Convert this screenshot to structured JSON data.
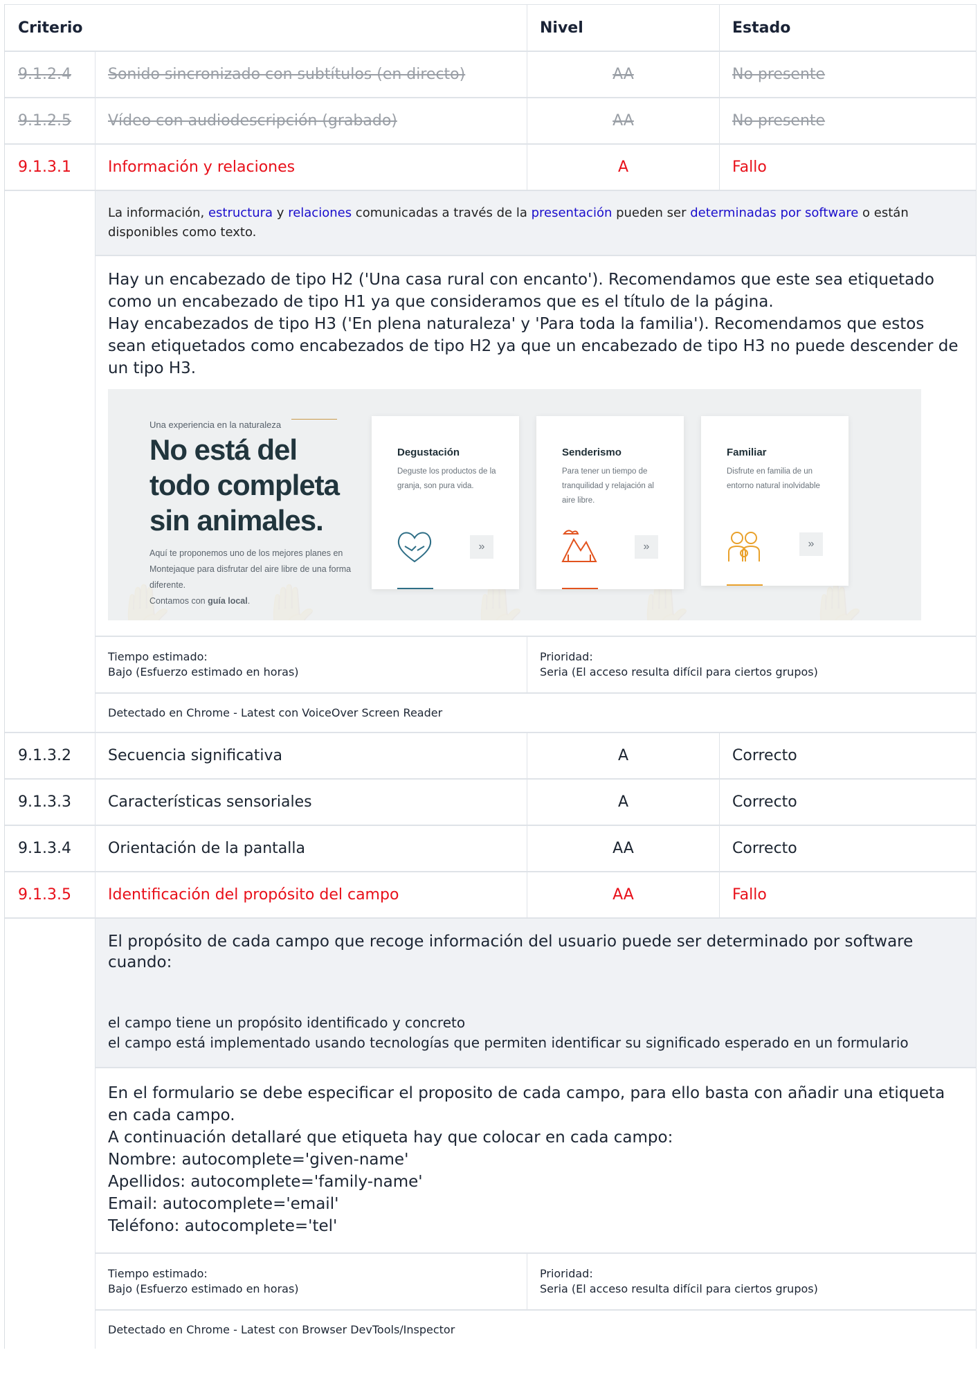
{
  "header": {
    "criterio": "Criterio",
    "nivel": "Nivel",
    "estado": "Estado"
  },
  "rows": [
    {
      "id": "9.1.2.4",
      "name": "Sonido sincronizado con subtítulos (en directo)",
      "level": "AA",
      "status": "No presente"
    },
    {
      "id": "9.1.2.5",
      "name": "Vídeo con audiodescripción (grabado)",
      "level": "AA",
      "status": "No presente"
    },
    {
      "id": "9.1.3.1",
      "name": "Información y relaciones",
      "level": "A",
      "status": "Fallo"
    },
    {
      "id": "9.1.3.2",
      "name": "Secuencia significativa",
      "level": "A",
      "status": "Correcto"
    },
    {
      "id": "9.1.3.3",
      "name": "Características sensoriales",
      "level": "A",
      "status": "Correcto"
    },
    {
      "id": "9.1.3.4",
      "name": "Orientación de la pantalla",
      "level": "AA",
      "status": "Correcto"
    },
    {
      "id": "9.1.3.5",
      "name": "Identificación del propósito del campo",
      "level": "AA",
      "status": "Fallo"
    }
  ],
  "detail_1": {
    "desc": {
      "t1": "La información, ",
      "l1": "estructura",
      "t2": " y ",
      "l2": "relaciones",
      "t3": " comunicadas a través de la ",
      "l3": "presentación",
      "t4": " pueden ser ",
      "l4": "determinadas por software",
      "t5": " o están disponibles como texto."
    },
    "note_lines": [
      "Hay un encabezado de tipo H2 ('Una casa rural con encanto'). Recomendamos que este sea etiquetado como un encabezado de tipo H1 ya que consideramos que es el título de la página.",
      "Hay encabezados de tipo H3 ('En plena naturaleza' y 'Para toda la familia'). Recomendamos que estos sean etiquetados como encabezados de tipo H2 ya que un encabezado de tipo H3 no puede descender de un tipo H3."
    ],
    "shot": {
      "eyebrow": "Una experiencia en la naturaleza",
      "headline": "No está del todo completa sin animales.",
      "body_1": "Aquí te proponemos uno de los mejores planes en Montejaque para disfrutar del aire libre de una forma diferente.",
      "body_2a": "Contamos con ",
      "body_2b": "guía local",
      "body_2c": ".",
      "cards": [
        {
          "title": "Degustación",
          "text": "Deguste los productos de la granja, son pura vida.",
          "icon": "heart-hands-icon",
          "color": "#2e6e86"
        },
        {
          "title": "Senderismo",
          "text": "Para tener un tiempo de tranquilidad y relajación al aire libre.",
          "icon": "mountain-trees-icon",
          "color": "#e2531e"
        },
        {
          "title": "Familiar",
          "text": "Disfrute en familia de un entorno natural inolvidable",
          "icon": "family-icon",
          "color": "#e9a12c"
        }
      ],
      "arrow": "»"
    },
    "tiempo_label": "Tiempo estimado:",
    "tiempo_value": "Bajo (Esfuerzo estimado en horas)",
    "prioridad_label": "Prioridad:",
    "prioridad_value": "Seria (El acceso resulta difícil para ciertos grupos)",
    "detected": "Detectado en Chrome - Latest con VoiceOver Screen Reader"
  },
  "detail_2": {
    "desc_main": "El propósito de cada campo que recoge información del usuario puede ser determinado por software cuando:",
    "desc_items": [
      "el campo tiene un propósito identificado y concreto",
      "el campo está implementado usando tecnologías que permiten identificar su significado esperado en un formulario"
    ],
    "note_lines": [
      "En el formulario se debe especificar el proposito de cada campo, para ello basta con añadir una etiqueta en cada campo.",
      "A continuación detallaré que etiqueta hay que colocar en cada campo:",
      "Nombre: autocomplete='given-name'",
      "Apellidos: autocomplete='family-name'",
      "Email: autocomplete='email'",
      "Teléfono: autocomplete='tel'"
    ],
    "tiempo_label": "Tiempo estimado:",
    "tiempo_value": "Bajo (Esfuerzo estimado en horas)",
    "prioridad_label": "Prioridad:",
    "prioridad_value": "Seria (El acceso resulta difícil para ciertos grupos)",
    "detected": "Detectado en Chrome - Latest con Browser DevTools/Inspector"
  },
  "colors": {
    "fail": "#e8101a",
    "link": "#1a0dcc",
    "strike": "#9a9fa6",
    "desc_bg": "#f0f2f5"
  }
}
